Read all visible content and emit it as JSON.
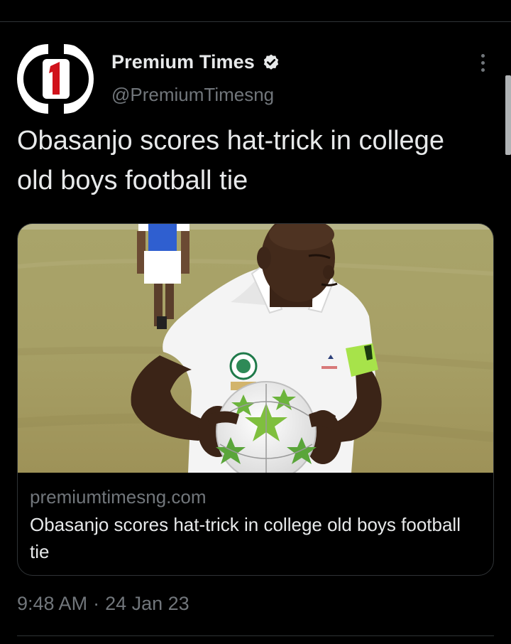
{
  "tweet": {
    "author": {
      "display_name": "Premium Times",
      "handle": "@PremiumTimesng",
      "verified": true,
      "avatar_icon": "premium-times-logo"
    },
    "text": "Obasanjo scores hat-trick in college old boys football tie",
    "card": {
      "domain": "premiumtimesng.com",
      "title": "Obasanjo scores hat-trick in college old boys football tie",
      "image": "photo of a man in a white polo shirt and green captain armband holding a white and green star football on a grass pitch"
    },
    "time": "9:48 AM",
    "separator": "·",
    "date": "24 Jan 23"
  },
  "colors": {
    "background": "#000000",
    "text_primary": "#e7e9ea",
    "text_secondary": "#71767b",
    "border": "#2f3336",
    "verified_badge": "#e7e9ea"
  }
}
